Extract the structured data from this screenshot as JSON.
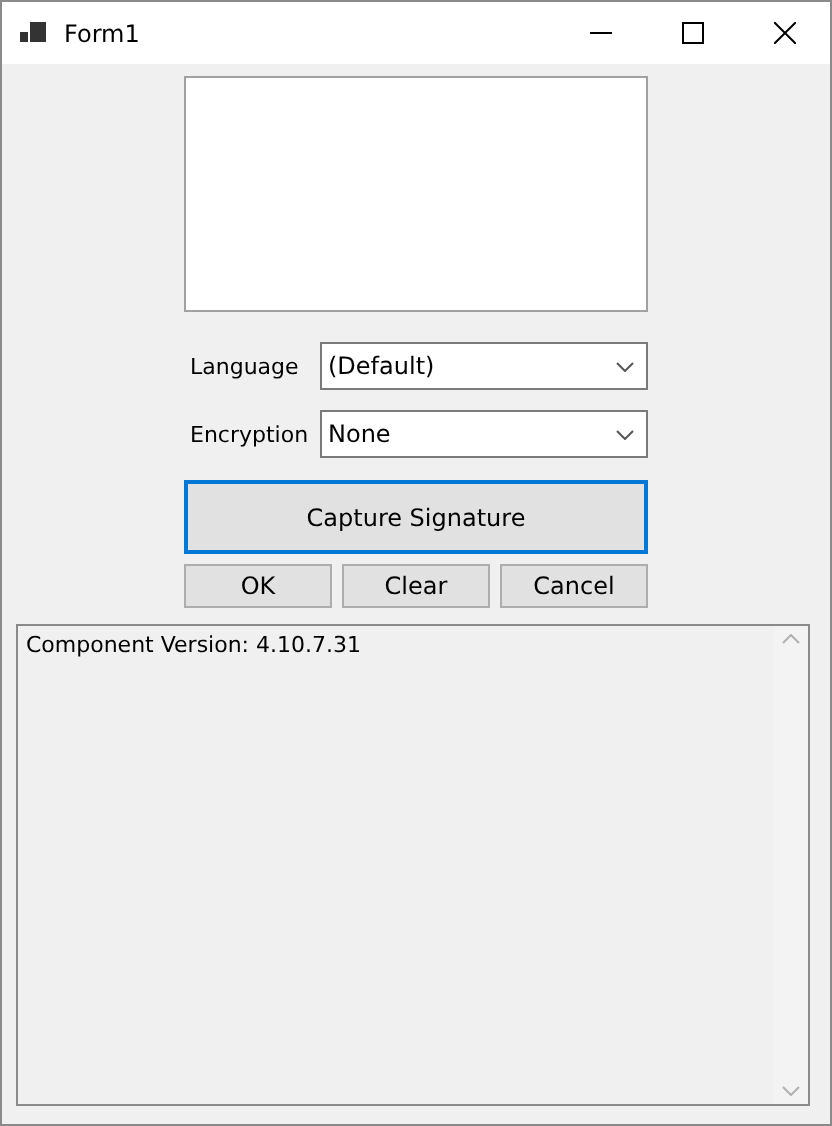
{
  "window": {
    "title": "Form1"
  },
  "fields": [
    {
      "label": "Language",
      "value": "(Default)"
    },
    {
      "label": "Encryption",
      "value": "None"
    }
  ],
  "capture_button": {
    "label": "Capture Signature",
    "focused": true
  },
  "buttons": [
    "OK",
    "Clear",
    "Cancel"
  ],
  "log": {
    "lines": [
      "Component Version: 4.10.7.31"
    ]
  }
}
